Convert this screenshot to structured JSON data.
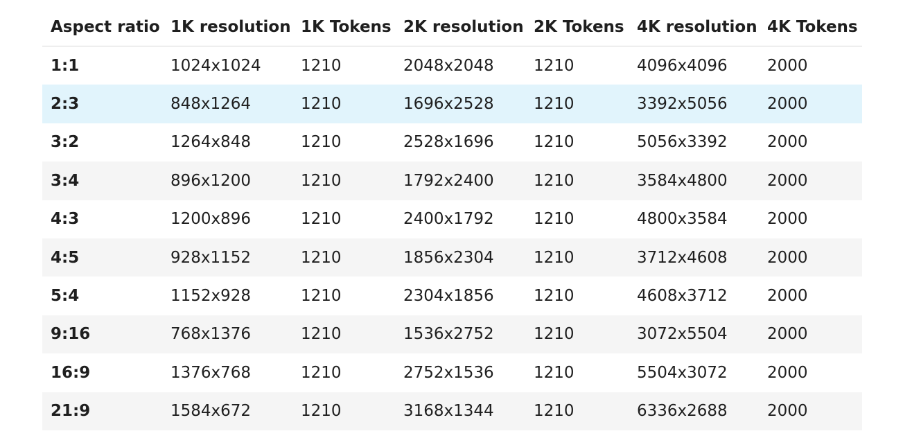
{
  "table": {
    "headers": [
      "Aspect ratio",
      "1K resolution",
      "1K Tokens",
      "2K resolution",
      "2K Tokens",
      "4K resolution",
      "4K Tokens"
    ],
    "rows": [
      [
        "1:1",
        "1024x1024",
        "1210",
        "2048x2048",
        "1210",
        "4096x4096",
        "2000"
      ],
      [
        "2:3",
        "848x1264",
        "1210",
        "1696x2528",
        "1210",
        "3392x5056",
        "2000"
      ],
      [
        "3:2",
        "1264x848",
        "1210",
        "2528x1696",
        "1210",
        "5056x3392",
        "2000"
      ],
      [
        "3:4",
        "896x1200",
        "1210",
        "1792x2400",
        "1210",
        "3584x4800",
        "2000"
      ],
      [
        "4:3",
        "1200x896",
        "1210",
        "2400x1792",
        "1210",
        "4800x3584",
        "2000"
      ],
      [
        "4:5",
        "928x1152",
        "1210",
        "1856x2304",
        "1210",
        "3712x4608",
        "2000"
      ],
      [
        "5:4",
        "1152x928",
        "1210",
        "2304x1856",
        "1210",
        "4608x3712",
        "2000"
      ],
      [
        "9:16",
        "768x1376",
        "1210",
        "1536x2752",
        "1210",
        "3072x5504",
        "2000"
      ],
      [
        "16:9",
        "1376x768",
        "1210",
        "2752x1536",
        "1210",
        "5504x3072",
        "2000"
      ],
      [
        "21:9",
        "1584x672",
        "1210",
        "3168x1344",
        "1210",
        "6336x2688",
        "2000"
      ]
    ],
    "highlighted_row": 1,
    "colors": {
      "header_border": "#d6d6d6",
      "stripe": "#f5f5f5",
      "highlight": "#e1f4fc",
      "text": "#1f1f1f"
    }
  }
}
